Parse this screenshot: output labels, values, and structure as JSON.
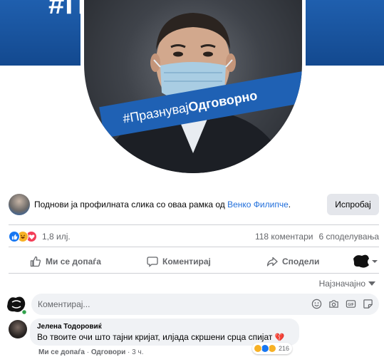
{
  "cover": {
    "headline": "#Пр                     орно"
  },
  "profile_frame": {
    "hashtag_plain": "#Празнувај",
    "hashtag_bold": "Одговорно"
  },
  "frame_prompt": {
    "text": "Поднови ја профилната слика со оваа рамка од ",
    "author_link": "Венко Филипче",
    "suffix": ".",
    "button": "Испробај"
  },
  "reactions": {
    "icons": [
      "like-icon",
      "haha-icon",
      "love-icon"
    ],
    "count": "1,8 илј.",
    "comments": "118 коментари",
    "shares": "6 споделувања"
  },
  "actions": {
    "like": "Ми се допаѓа",
    "comment": "Коментирај",
    "share": "Сподели"
  },
  "sort": {
    "label": "Најзначајно"
  },
  "composer": {
    "placeholder": "Коментирај..."
  },
  "comment": {
    "author": "Јелена Тодоровиќ",
    "text": "Во твоите очи што тајни кријат, илјада скршени срца спијат",
    "emoji": "💔",
    "reaction_count": "216",
    "like": "Ми се допаѓа",
    "separator": "·",
    "reply": "Одговори",
    "time": "3 ч."
  },
  "colors": {
    "brand_blue": "#1877f2",
    "frame_blue": "#1f61b4",
    "link": "#216fdb",
    "secondary_text": "#65676b",
    "button_bg": "#e4e6eb",
    "input_bg": "#f0f2f5"
  }
}
